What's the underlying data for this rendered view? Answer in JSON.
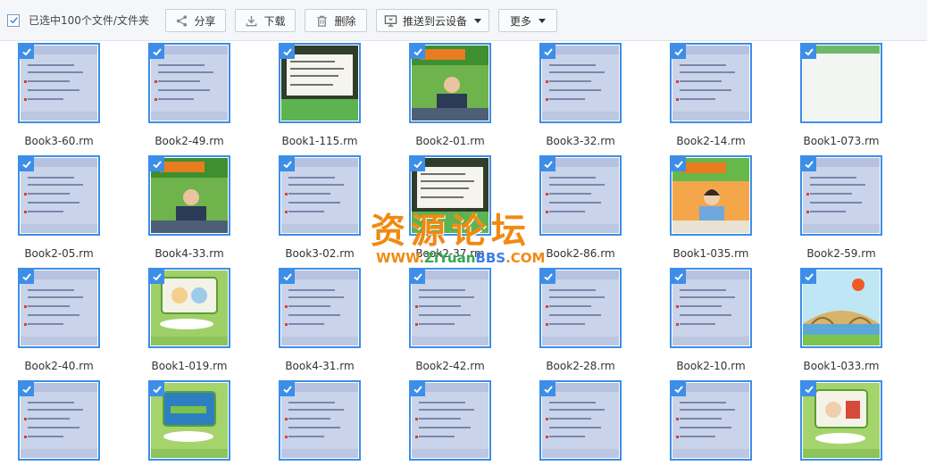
{
  "toolbar": {
    "select_label": "已选中100个文件/文件夹",
    "share_label": "分享",
    "download_label": "下载",
    "delete_label": "删除",
    "push_label": "推送到云设备",
    "more_label": "更多"
  },
  "icons": {
    "checkbox": "check-icon",
    "share": "share-icon",
    "download": "download-icon",
    "delete": "trash-icon",
    "push": "monitor-icon",
    "caret": "chevron-down-icon"
  },
  "colors": {
    "accent": "#3c8ee8",
    "watermark": "#f08a12"
  },
  "files": [
    [
      "Book3-60.rm",
      "Book2-49.rm",
      "Book1-115.rm",
      "Book2-01.rm",
      "Book3-32.rm",
      "Book2-14.rm",
      "Book1-073.rm"
    ],
    [
      "Book2-05.rm",
      "Book4-33.rm",
      "Book3-02.rm",
      "Book2-37.rm",
      "Book2-86.rm",
      "Book1-035.rm",
      "Book2-59.rm"
    ],
    [
      "Book2-40.rm",
      "Book1-019.rm",
      "Book4-31.rm",
      "Book2-42.rm",
      "Book2-28.rm",
      "Book2-10.rm",
      "Book1-033.rm"
    ],
    [
      "",
      "",
      "",
      "",
      "",
      "",
      ""
    ]
  ],
  "watermark": {
    "big": "资源论坛",
    "small_a": "WWW.",
    "small_b": "ZiYuan",
    "small_c": "BBS",
    "small_d": ".COM"
  }
}
